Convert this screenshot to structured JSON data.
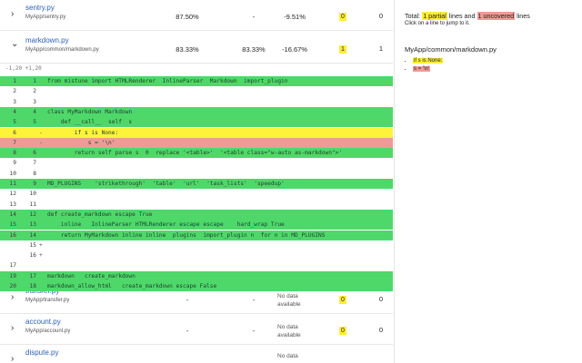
{
  "files": [
    {
      "name": "sentry.py",
      "path": "MyApp/sentry.py",
      "chevron": "›",
      "cov1": "87.50%",
      "cov2": "-",
      "delta": "-9.51%",
      "partial": "0",
      "uncovered": "0",
      "partial_hl": true,
      "uncovered_hl": false
    },
    {
      "name": "markdown.py",
      "path": "MyApp/common/markdown.py",
      "chevron": "⌄",
      "cov1": "83.33%",
      "cov2": "83.33%",
      "delta": "-16.67%",
      "partial": "1",
      "uncovered": "1",
      "partial_hl": true,
      "uncovered_hl": false
    },
    {
      "name": "transfer.py",
      "path": "MyApp/transfer.py",
      "chevron": "›",
      "cov1": "-",
      "cov2": "-",
      "nodata1": "No data",
      "nodata2": "available",
      "partial": "0",
      "uncovered": "0",
      "partial_hl": true,
      "uncovered_hl": false
    },
    {
      "name": "account.py",
      "path": "MyApp/account.py",
      "chevron": "›",
      "cov1": "-",
      "cov2": "-",
      "nodata1": "No data",
      "nodata2": "available",
      "partial": "0",
      "uncovered": "0",
      "partial_hl": true,
      "uncovered_hl": false
    },
    {
      "name": "dispute.py",
      "path": "",
      "chevron": "›",
      "cov1": "",
      "cov2": "",
      "nodata1": "No data",
      "nodata2": "",
      "partial": "",
      "uncovered": "",
      "partial_hl": false,
      "uncovered_hl": false
    }
  ],
  "code": {
    "hunk": "-1,20 +1,20",
    "lines": [
      {
        "a": "1",
        "b": "1",
        "m": "",
        "t": "from mistune import HTMLRenderer  InlineParser  Markdown  import_plugin",
        "s": "cov"
      },
      {
        "a": "2",
        "b": "2",
        "m": "",
        "t": "",
        "s": "plain"
      },
      {
        "a": "3",
        "b": "3",
        "m": "",
        "t": "",
        "s": "plain"
      },
      {
        "a": "4",
        "b": "4",
        "m": "",
        "t": "class MyMarkdown Markdown",
        "s": "cov"
      },
      {
        "a": "5",
        "b": "5",
        "m": "",
        "t": "    def __call__  self  s",
        "s": "cov"
      },
      {
        "a": "6",
        "b": "",
        "m": "-",
        "t": "        if s is None:",
        "s": "part"
      },
      {
        "a": "7",
        "b": "",
        "m": "-",
        "t": "            s = '\\n'",
        "s": "unc"
      },
      {
        "a": "8",
        "b": "6",
        "m": "",
        "t": "        return self parse s  0  replace '<table>'  '<table class=\"w-auto as-markdown\">'",
        "s": "cov"
      },
      {
        "a": "9",
        "b": "7",
        "m": "",
        "t": "",
        "s": "plain"
      },
      {
        "a": "10",
        "b": "8",
        "m": "",
        "t": "",
        "s": "plain"
      },
      {
        "a": "11",
        "b": "9",
        "m": "",
        "t": "MD_PLUGINS    'strikethrough'  'table'  'url'  'task_lists'  'speedup'",
        "s": "cov"
      },
      {
        "a": "12",
        "b": "10",
        "m": "",
        "t": "",
        "s": "plain"
      },
      {
        "a": "13",
        "b": "11",
        "m": "",
        "t": "",
        "s": "plain"
      },
      {
        "a": "14",
        "b": "12",
        "m": "",
        "t": "def create_markdown escape True",
        "s": "cov"
      },
      {
        "a": "15",
        "b": "13",
        "m": "",
        "t": "    inline   InlineParser HTMLRenderer escape escape    hard_wrap True",
        "s": "cov"
      },
      {
        "a": "16",
        "b": "14",
        "m": "",
        "t": "    return MyMarkdown inline inline  plugins  import_plugin n  for n in MD_PLUGINS",
        "s": "cov"
      },
      {
        "a": "",
        "b": "15",
        "m": "+",
        "t": "",
        "s": "plain"
      },
      {
        "a": "",
        "b": "16",
        "m": "+",
        "t": "",
        "s": "plain"
      },
      {
        "a": "17",
        "b": "",
        "m": "",
        "t": "",
        "s": "plain"
      },
      {
        "a": "19",
        "b": "17",
        "m": "",
        "t": "markdown   create_markdown",
        "s": "cov"
      },
      {
        "a": "20",
        "b": "18",
        "m": "",
        "t": "markdown_allow_html   create_markdown escape False",
        "s": "cov"
      }
    ]
  },
  "panel": {
    "total_prefix": "Total: ",
    "partial_count": "1 partial",
    "mid": " lines and ",
    "uncovered_count": "1 uncovered",
    "suffix": " lines",
    "hint": "Click on a line to jump to it.",
    "file_title": "MyApp/common/markdown.py",
    "items": [
      {
        "text": "if s is None:",
        "kind": "partial"
      },
      {
        "text": "s = '\\n'",
        "kind": "uncovered"
      }
    ]
  },
  "colors": {
    "covered": "#4ed86a",
    "partial": "#fcf33a",
    "uncovered": "#f09a95",
    "link": "#2b5fb6"
  }
}
